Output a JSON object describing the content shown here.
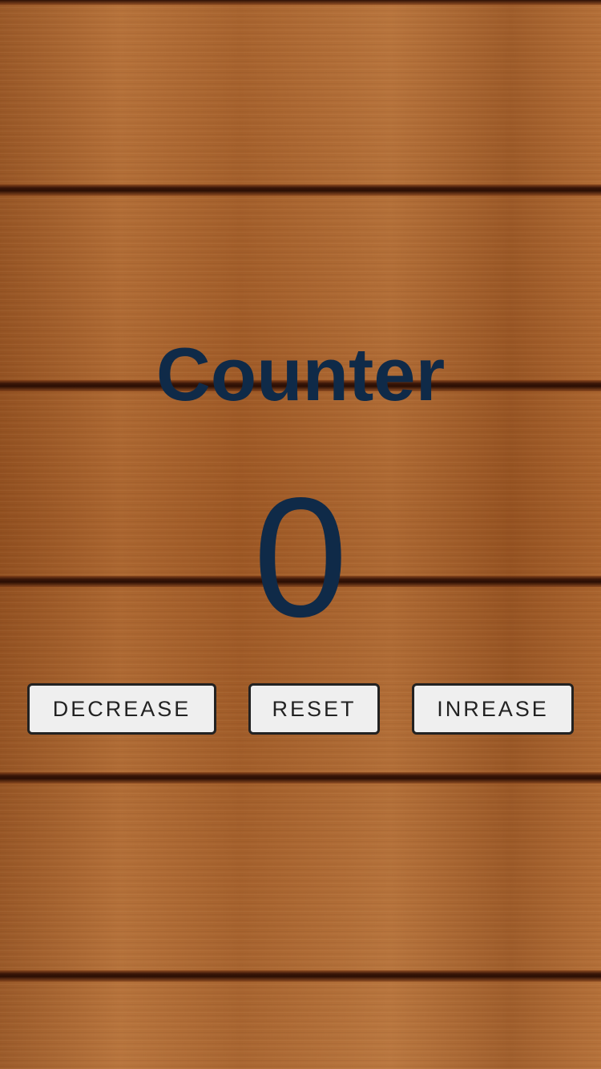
{
  "title": "Counter",
  "count": "0",
  "buttons": {
    "decrease": "DECREASE",
    "reset": "RESET",
    "increase": "INREASE"
  },
  "colors": {
    "text": "#0f2a48",
    "button_bg": "#efefef",
    "button_border": "#222222",
    "wood": "#a8622c"
  }
}
